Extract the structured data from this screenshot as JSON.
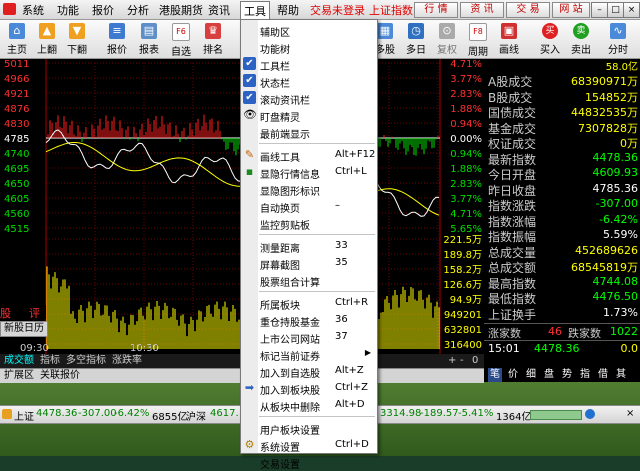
{
  "menubar": {
    "items": [
      "系统",
      "功能",
      "报价",
      "分析",
      "港股期货",
      "资讯",
      "工具",
      "帮助"
    ],
    "status_red": [
      "交易未登录",
      "上证指数"
    ],
    "buttons": [
      "行 情",
      "资 讯",
      "交 易",
      "网 站"
    ],
    "window_buttons": [
      "–",
      "□",
      "×"
    ]
  },
  "toolbar": {
    "buttons": [
      {
        "label": "主页",
        "icon": "home-icon"
      },
      {
        "label": "上翻",
        "icon": "page-up-icon"
      },
      {
        "label": "下翻",
        "icon": "page-down-icon"
      },
      {
        "label": "报价",
        "icon": "quote-icon"
      },
      {
        "label": "报表",
        "icon": "report-icon"
      },
      {
        "label": "自选",
        "icon": "favorites-icon",
        "badge": "F6"
      },
      {
        "label": "排名",
        "icon": "rank-icon"
      }
    ],
    "right_buttons": [
      {
        "label": "多股",
        "icon": "multi-stock-icon"
      },
      {
        "label": "多日",
        "icon": "multi-day-icon"
      },
      {
        "label": "复权",
        "icon": "adjust-icon"
      },
      {
        "label": "周期",
        "icon": "period-icon",
        "badge": "F8"
      },
      {
        "label": "画线",
        "icon": "draw-line-icon"
      },
      {
        "label": "买入",
        "icon": "buy-icon",
        "badge": "买"
      },
      {
        "label": "卖出",
        "icon": "sell-icon",
        "badge": "卖"
      },
      {
        "label": "分时",
        "icon": "timeshare-icon"
      }
    ]
  },
  "chart": {
    "price_ticks": [
      "5011",
      "4966",
      "4921",
      "4876",
      "4830",
      "4785",
      "4740",
      "4695",
      "4650",
      "4605",
      "4560",
      "4515"
    ],
    "pct_ticks": [
      "4.71%",
      "3.77%",
      "2.83%",
      "1.88%",
      "0.94%",
      "0.00%",
      "0.94%",
      "1.88%",
      "2.83%",
      "3.77%",
      "4.71%",
      "5.65%"
    ],
    "vol_ticks": [
      "221.5万",
      "189.8万",
      "158.2万",
      "126.6万",
      "94.9万",
      "949201",
      "632801",
      "316400"
    ],
    "time_labels": [
      "09:30",
      "10:30"
    ],
    "side_labels": [
      "股",
      "评"
    ],
    "side_button": "新股日历",
    "header_value": "58.0亿",
    "base_price": 4785.36
  },
  "right_panel": {
    "rows": [
      {
        "k": "A股成交",
        "v": "68390971万",
        "vc": "#ffff00"
      },
      {
        "k": "B股成交",
        "v": "154852万",
        "vc": "#ffff00"
      },
      {
        "k": "国债成交",
        "v": "44832535万",
        "vc": "#ffff00"
      },
      {
        "k": "基金成交",
        "v": "7307828万",
        "vc": "#ffff00"
      },
      {
        "k": "权证成交",
        "v": "0万",
        "vc": "#ffff00"
      },
      {
        "k": "最新指数",
        "v": "4478.36",
        "vc": "#00ff00"
      },
      {
        "k": "今日开盘",
        "v": "4609.93",
        "vc": "#00ff00"
      },
      {
        "k": "昨日收盘",
        "v": "4785.36",
        "vc": "#ffffff"
      },
      {
        "k": "指数涨跌",
        "v": "-307.00",
        "vc": "#00ff00"
      },
      {
        "k": "指数涨幅",
        "v": "-6.42%",
        "vc": "#00ff00"
      },
      {
        "k": "指数振幅",
        "v": "5.59%",
        "vc": "#ffffff"
      },
      {
        "k": "总成交量",
        "v": "452689626",
        "vc": "#ffff00"
      },
      {
        "k": "总成交额",
        "v": "68545819万",
        "vc": "#ffff00"
      },
      {
        "k": "最高指数",
        "v": "4744.08",
        "vc": "#00ff00"
      },
      {
        "k": "最低指数",
        "v": "4476.50",
        "vc": "#00ff00"
      },
      {
        "k": "上证换手",
        "v": "1.73%",
        "vc": "#ffffff"
      }
    ],
    "rise_label": "涨家数",
    "rise_count": "46",
    "fall_label": "跌家数",
    "fall_count": "1022",
    "time": "15:01",
    "last": "4478.36",
    "vol": "0.0",
    "tabs": [
      "笔",
      "价",
      "细",
      "盘",
      "势",
      "指",
      "借",
      "其"
    ]
  },
  "bottom_tabs": {
    "row1": [
      "成交额",
      "指标",
      "多空指标",
      "涨跌率"
    ],
    "row1_right": [
      "+",
      "-",
      "0"
    ],
    "row2": [
      "扩展区",
      "关联报价"
    ]
  },
  "statusbar": {
    "sh_label": "上证",
    "sh_value": "4478.36",
    "sh_change": "-307.00",
    "sh_pct": "-6.42%",
    "sh_amount": "6855亿",
    "hs_label": "沪深",
    "hs_value": "4617.",
    "other_value": "3314.98",
    "other_change": "-189.57",
    "other_pct": "-5.41%",
    "other_amount": "1364亿"
  },
  "dropdown": {
    "items": [
      {
        "label": "辅助区",
        "shortcut": "",
        "check": false,
        "icon": ""
      },
      {
        "label": "功能树",
        "shortcut": "",
        "check": false,
        "icon": ""
      },
      {
        "label": "工具栏",
        "shortcut": "",
        "check": true,
        "icon": ""
      },
      {
        "label": "状态栏",
        "shortcut": "",
        "check": true,
        "icon": ""
      },
      {
        "label": "滚动资讯栏",
        "shortcut": "",
        "check": true,
        "icon": ""
      },
      {
        "label": "盯盘精灵",
        "shortcut": "",
        "check": false,
        "icon": "eye-icon"
      },
      {
        "label": "最前端显示",
        "shortcut": "",
        "check": false,
        "icon": ""
      },
      {
        "sep": true
      },
      {
        "label": "画线工具",
        "shortcut": "Alt+F12",
        "check": false,
        "icon": "pencil-icon"
      },
      {
        "label": "显隐行情信息",
        "shortcut": "Ctrl+L",
        "check": false,
        "icon": "info-icon"
      },
      {
        "label": "显隐图形标识",
        "shortcut": "",
        "check": false,
        "icon": ""
      },
      {
        "label": "自动换页",
        "shortcut": "–",
        "check": false,
        "icon": ""
      },
      {
        "label": "监控剪贴板",
        "shortcut": "",
        "check": false,
        "icon": ""
      },
      {
        "sep": true
      },
      {
        "label": "测量距离",
        "shortcut": "33",
        "check": false,
        "icon": ""
      },
      {
        "label": "屏幕截图",
        "shortcut": "35",
        "check": false,
        "icon": ""
      },
      {
        "label": "股票组合计算",
        "shortcut": "",
        "check": false,
        "icon": ""
      },
      {
        "sep": true
      },
      {
        "label": "所属板块",
        "shortcut": "Ctrl+R",
        "check": false,
        "icon": ""
      },
      {
        "label": "重仓持股基金",
        "shortcut": "36",
        "check": false,
        "icon": ""
      },
      {
        "label": "上市公司网站",
        "shortcut": "37",
        "check": false,
        "icon": ""
      },
      {
        "label": "标记当前证券",
        "shortcut": "",
        "check": false,
        "icon": "",
        "submenu": "▶"
      },
      {
        "label": "加入到自选股",
        "shortcut": "Alt+Z",
        "check": false,
        "icon": ""
      },
      {
        "label": "加入到板块股",
        "shortcut": "Ctrl+Z",
        "check": false,
        "icon": "arrow-icon"
      },
      {
        "label": "从板块中删除",
        "shortcut": "Alt+D",
        "check": false,
        "icon": ""
      },
      {
        "sep": true
      },
      {
        "label": "用户板块设置",
        "shortcut": "",
        "check": false,
        "icon": ""
      },
      {
        "label": "系统设置",
        "shortcut": "Ctrl+D",
        "check": false,
        "icon": "gear-icon"
      },
      {
        "label": "交易设置",
        "shortcut": "",
        "check": false,
        "icon": ""
      }
    ]
  },
  "colors": {
    "rise": "#ff2020",
    "fall": "#00dd00",
    "price_line": "#ffffff",
    "avg_line": "#ffff00",
    "grid": "#7a0000",
    "accent": "#2b62c4"
  }
}
